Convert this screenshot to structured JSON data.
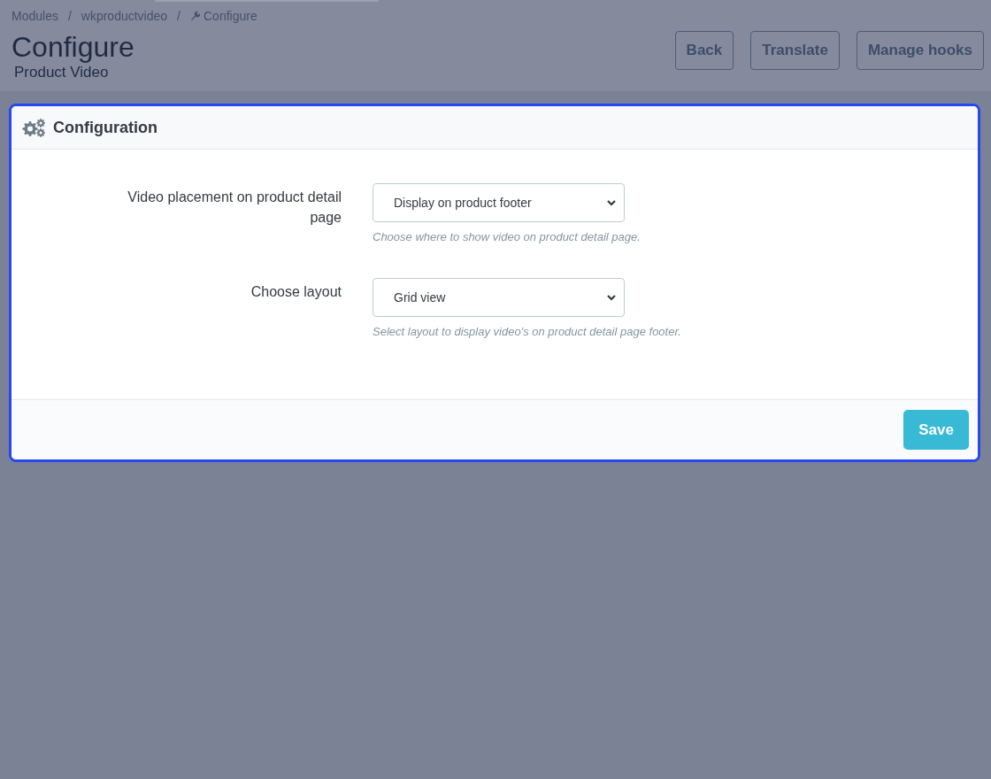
{
  "breadcrumb": [
    {
      "label": "Modules",
      "kind": "link",
      "separator": "/"
    },
    {
      "label": "wkproductvideo",
      "kind": "link",
      "separator": "/"
    },
    {
      "label": "Configure",
      "kind": "current"
    }
  ],
  "page_title": "Configure",
  "page_subtitle": "Product Video",
  "toolbar_buttons": [
    {
      "label": "Back"
    },
    {
      "label": "Translate"
    },
    {
      "label": "Manage hooks"
    }
  ],
  "panel": {
    "title": "Configuration",
    "highlighted": true,
    "fields": [
      {
        "label": "Video placement on product detail page",
        "value": "Display on product footer",
        "help": "Choose where to show video on product detail page."
      },
      {
        "label": "Choose layout",
        "value": "Grid view",
        "help": "Select layout to display video's on product detail page footer."
      }
    ],
    "save_button": "Save"
  }
}
